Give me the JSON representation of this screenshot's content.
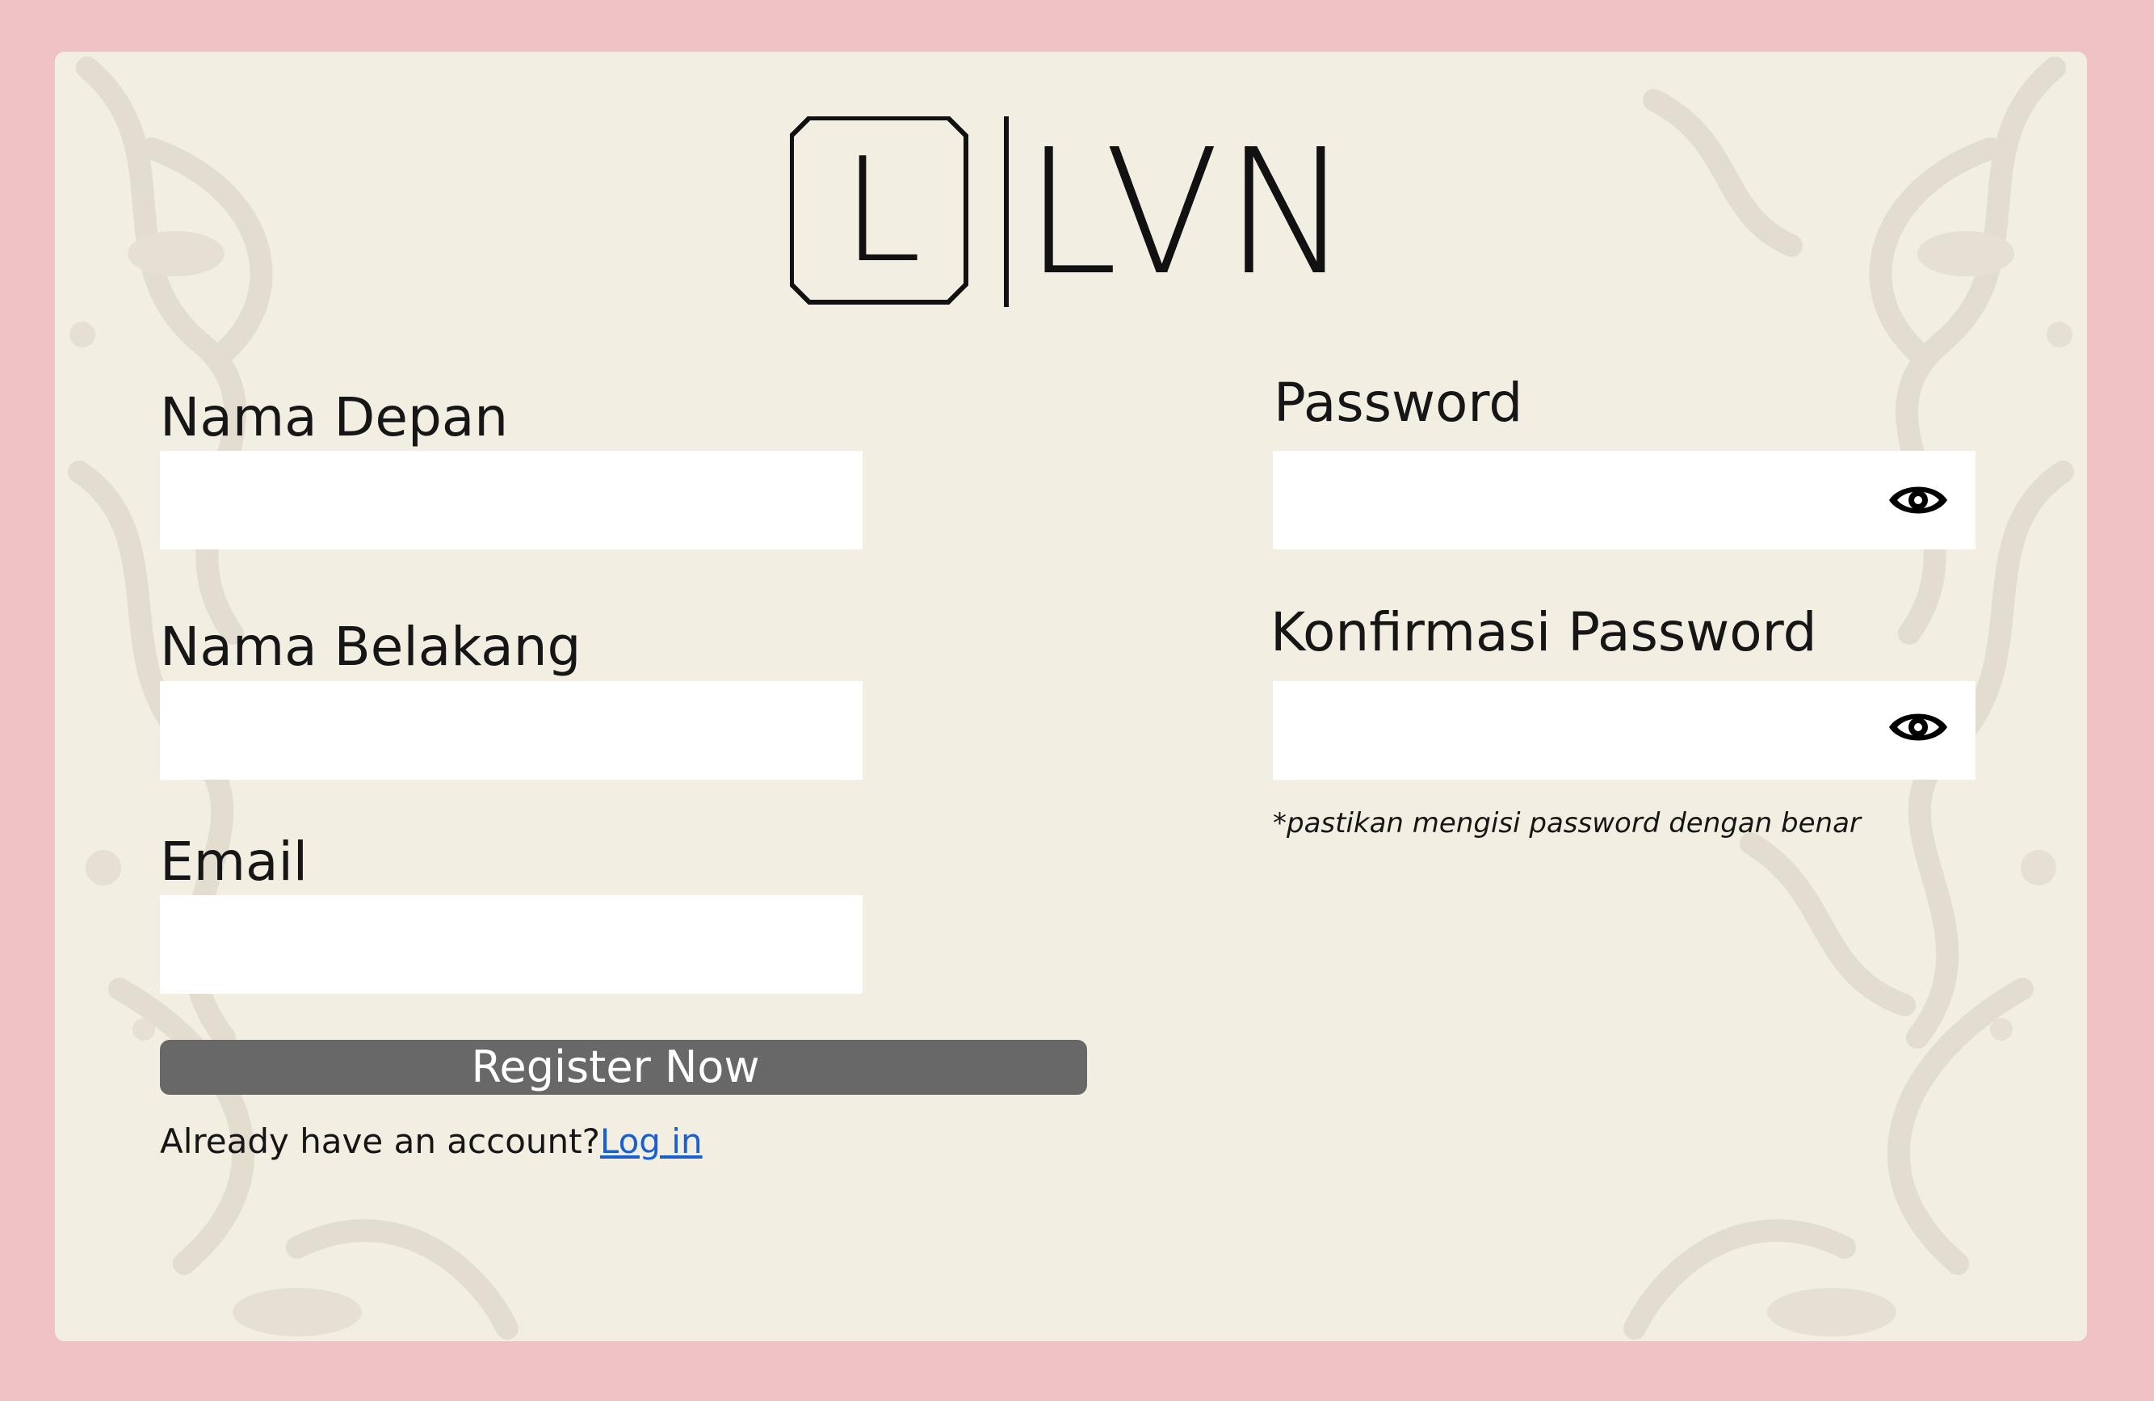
{
  "brand": {
    "logo_monogram": "L",
    "logo_text": "LVN"
  },
  "form": {
    "first_name": {
      "label": "Nama Depan",
      "value": "",
      "placeholder": ""
    },
    "last_name": {
      "label": "Nama Belakang",
      "value": "",
      "placeholder": ""
    },
    "email": {
      "label": "Email",
      "value": "",
      "placeholder": ""
    },
    "password": {
      "label": "Password",
      "value": "",
      "placeholder": ""
    },
    "confirm_password": {
      "label": "Konfirmasi Password",
      "value": "",
      "placeholder": ""
    },
    "password_hint": "*pastikan mengisi password dengan benar",
    "submit_label": "Register Now",
    "login_prompt": "Already have an account?",
    "login_link": "Log in"
  },
  "icons": {
    "show_password": "eye-icon",
    "show_confirm_password": "eye-icon"
  },
  "colors": {
    "page_background": "#efc3c5",
    "card_background": "#f3eee2",
    "button_background": "#686868",
    "link": "#1a5fd0"
  }
}
